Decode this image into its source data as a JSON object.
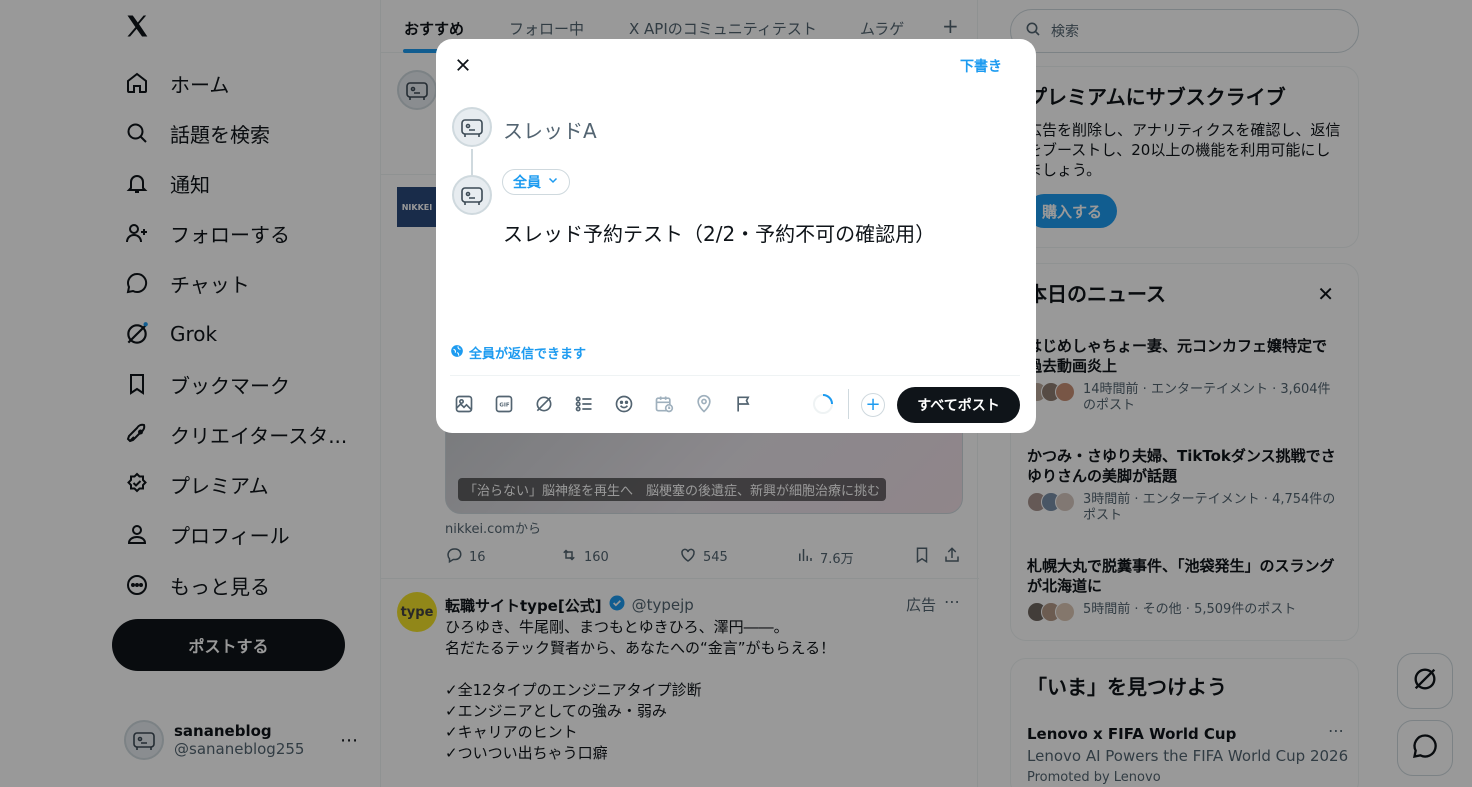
{
  "nav": {
    "items": [
      {
        "label": "ホーム",
        "icon": "home-icon"
      },
      {
        "label": "話題を検索",
        "icon": "search-icon"
      },
      {
        "label": "通知",
        "icon": "bell-icon"
      },
      {
        "label": "フォローする",
        "icon": "follow-icon"
      },
      {
        "label": "チャット",
        "icon": "chat-icon"
      },
      {
        "label": "Grok",
        "icon": "grok-icon"
      },
      {
        "label": "ブックマーク",
        "icon": "bookmark-icon"
      },
      {
        "label": "クリエイタースタ...",
        "icon": "rocket-icon"
      },
      {
        "label": "プレミアム",
        "icon": "premium-icon"
      },
      {
        "label": "プロフィール",
        "icon": "profile-icon"
      },
      {
        "label": "もっと見る",
        "icon": "more-icon"
      }
    ],
    "post_button": "ポストする",
    "account": {
      "name": "sananeblog",
      "handle": "@sananeblog255"
    }
  },
  "center": {
    "tabs": [
      "おすすめ",
      "フォロー中",
      "X APIのコミュニティテスト",
      "ムラゲ"
    ],
    "tab_add": "+",
    "media_caption": "「治らない」脳神経を再生へ　脳梗塞の後遺症、新興が細胞治療に挑む",
    "source": "nikkei.comから",
    "stats": {
      "replies": "16",
      "reposts": "160",
      "likes": "545",
      "views": "7.6万"
    },
    "ad": {
      "name": "転職サイトtype[公式]",
      "handle": "@typejp",
      "label": "広告",
      "avatar_text": "type",
      "text": "ひろゆき、牛尾剛、まつもとゆきひろ、澤円――。\n名だたるテック賢者から、あなたへの“金言”がもらえる！\n\n✓全12タイプのエンジニアタイプ診断\n✓エンジニアとしての強み・弱み\n✓キャリアのヒント\n✓ついつい出ちゃう口癖"
    }
  },
  "right": {
    "search_placeholder": "検索",
    "premium": {
      "title": "プレミアムにサブスクライブ",
      "body": "広告を削除し、アナリティクスを確認し、返信をブーストし、20以上の機能を利用可能にしましょう。",
      "button": "購入する"
    },
    "news": {
      "title": "本日のニュース",
      "items": [
        {
          "title": "はじめしゃちょー妻、元コンカフェ嬢特定で過去動画炎上",
          "meta": "14時間前 · エンターテイメント · 3,604件のポスト"
        },
        {
          "title": "かつみ・さゆり夫婦、TikTokダンス挑戦でさゆりさんの美脚が話題",
          "meta": "3時間前 · エンターテイメント · 4,754件のポスト"
        },
        {
          "title": "札幌大丸で脱糞事件、「池袋発生」のスラングが北海道に",
          "meta": "5時間前 · その他 · 5,509件のポスト"
        }
      ]
    },
    "find": {
      "title": "「いま」を見つけよう",
      "item_title": "Lenovo x FIFA World Cup",
      "item_subtitle": "Lenovo AI Powers the FIFA World Cup 2026",
      "promoted": "Promoted by Lenovo"
    }
  },
  "modal": {
    "draft_label": "下書き",
    "thread_placeholder": "スレッドA",
    "audience": "全員",
    "post_text": "スレッド予約テスト（2/2・予約不可の確認用）",
    "reply_setting": "全員が返信できます",
    "post_all_button": "すべてポスト",
    "add_label": "+"
  },
  "colors": {
    "accent": "#1d9bf0",
    "text": "#0f1419",
    "muted": "#536471",
    "overlay": "rgba(0,0,0,0.4)"
  }
}
